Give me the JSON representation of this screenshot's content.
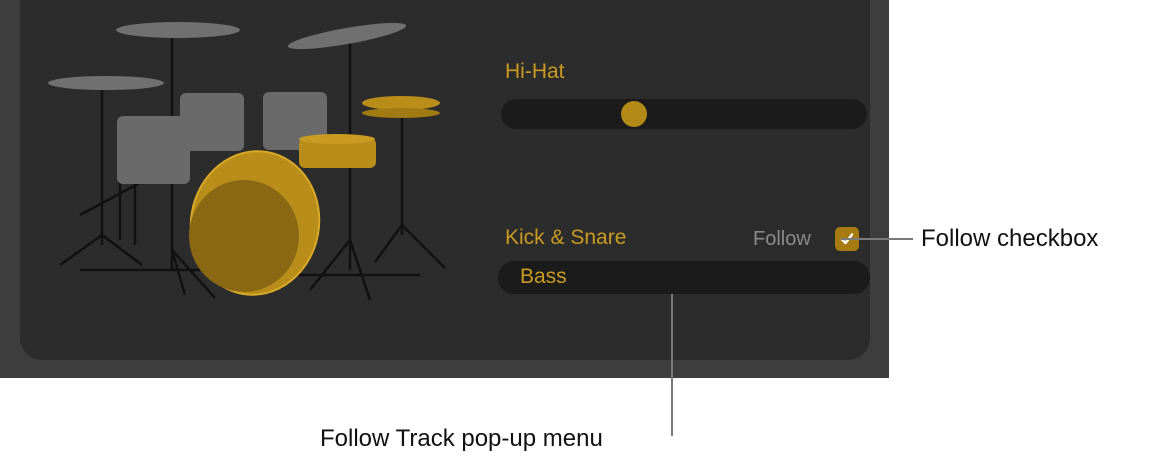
{
  "hihat": {
    "label": "Hi-Hat",
    "slider_value": 0.35
  },
  "kick_snare": {
    "label": "Kick & Snare",
    "follow_label": "Follow",
    "follow_checked": true,
    "track_value": "Bass"
  },
  "callouts": {
    "follow_checkbox": "Follow checkbox",
    "follow_track_menu": "Follow Track pop-up menu"
  },
  "colors": {
    "accent": "#c99b20",
    "panel": "#2c2c2c",
    "outer": "#3d3d3d"
  },
  "icons": {
    "kit": "drum-kit-icon",
    "check": "checkmark-icon"
  }
}
